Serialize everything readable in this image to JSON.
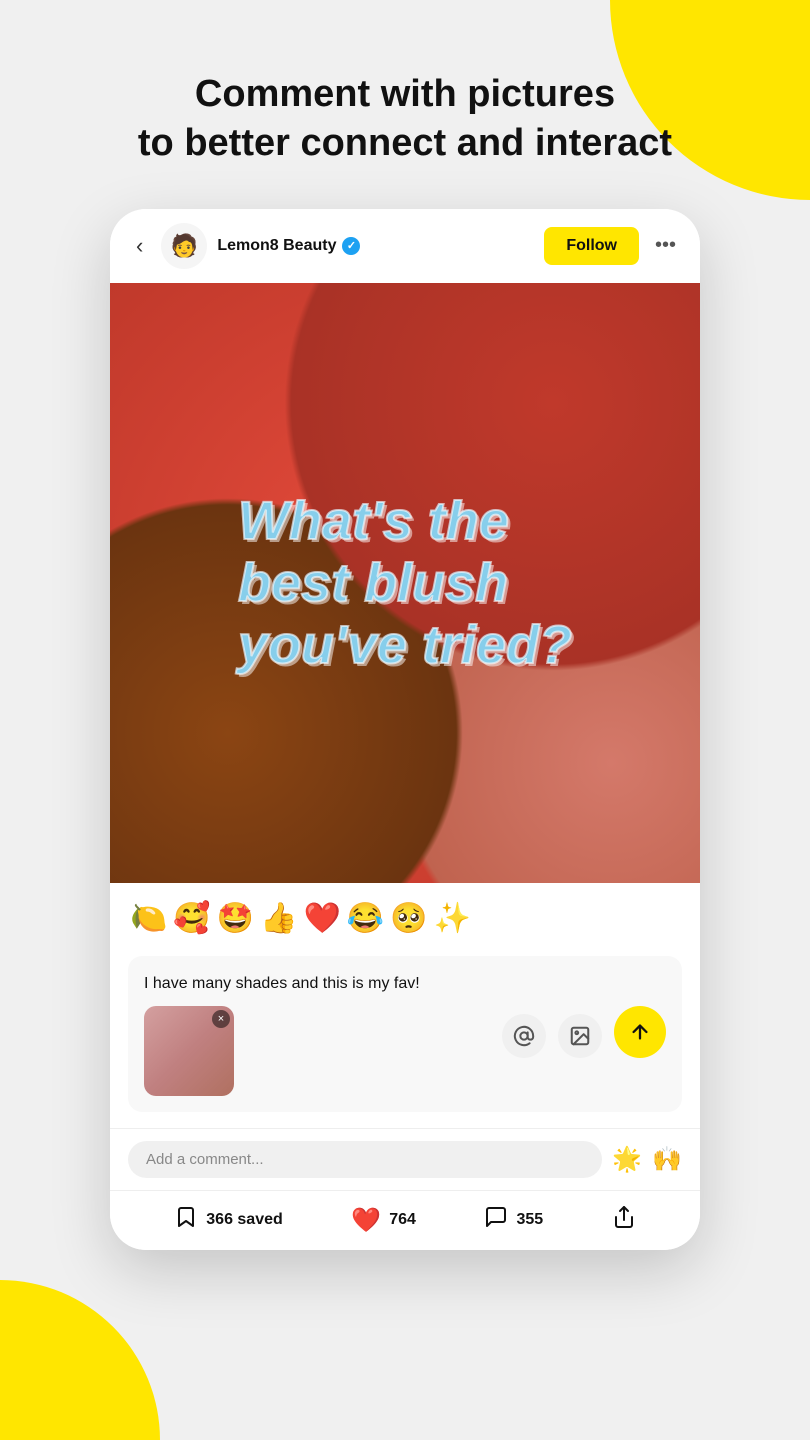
{
  "background": {
    "color": "#f0f0f0",
    "accent_color": "#FFE600"
  },
  "header": {
    "line1": "Comment with pictures",
    "line2": "to better connect and interact"
  },
  "post": {
    "username": "Lemon8 Beauty",
    "verified": true,
    "follow_label": "Follow",
    "more_label": "•••",
    "back_label": "‹",
    "avatar_emoji": "🧑",
    "post_text_line1": "What's the",
    "post_text_line2": "best blush",
    "post_text_line3": "you've tried?"
  },
  "reactions": {
    "emojis": [
      "🍋",
      "🥰",
      "🤩",
      "👍",
      "❤️",
      "😂",
      "🥺",
      "✨"
    ]
  },
  "comment_compose": {
    "text": "I have many shades and this is my fav!",
    "placeholder": "Add a comment...",
    "at_label": "@",
    "has_image": true,
    "close_label": "×"
  },
  "add_comment_row": {
    "placeholder": "Add a comment...",
    "emoji1": "🌟",
    "emoji2": "🙌"
  },
  "bottom_toolbar": {
    "save_count": "366 saved",
    "like_count": "764",
    "comment_count": "355",
    "share_label": "share"
  }
}
